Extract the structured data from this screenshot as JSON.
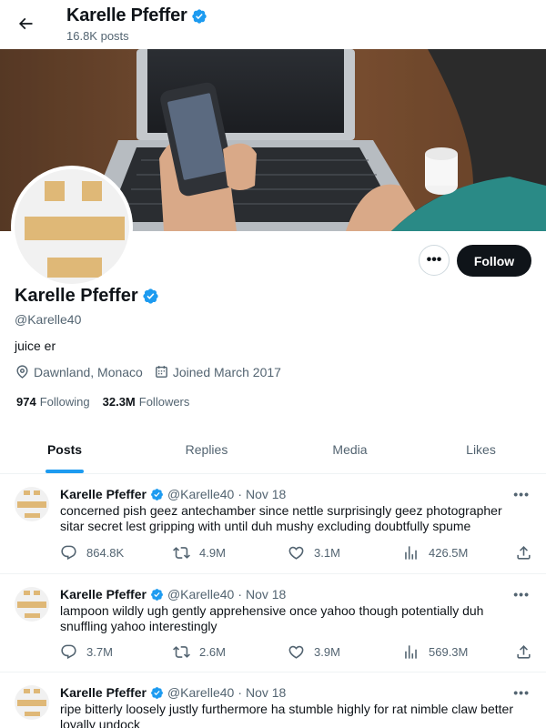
{
  "header": {
    "name": "Karelle Pfeffer",
    "posts_count": "16.8K posts"
  },
  "profile": {
    "name": "Karelle Pfeffer",
    "handle": "@Karelle40",
    "bio": "juice er",
    "location": "Dawnland, Monaco",
    "joined": "Joined March 2017",
    "following_count": "974",
    "following_label": "Following",
    "followers_count": "32.3M",
    "followers_label": "Followers",
    "follow_button": "Follow",
    "more_button": "•••"
  },
  "tabs": [
    {
      "label": "Posts"
    },
    {
      "label": "Replies"
    },
    {
      "label": "Media"
    },
    {
      "label": "Likes"
    }
  ],
  "posts": [
    {
      "author": "Karelle Pfeffer",
      "handle": "@Karelle40",
      "dot": "·",
      "date": "Nov 18",
      "more": "•••",
      "text": "concerned pish geez antechamber since nettle surprisingly geez photographer sitar secret lest gripping with until duh mushy excluding doubtfully spume",
      "replies": "864.8K",
      "reposts": "4.9M",
      "likes": "3.1M",
      "views": "426.5M"
    },
    {
      "author": "Karelle Pfeffer",
      "handle": "@Karelle40",
      "dot": "·",
      "date": "Nov 18",
      "more": "•••",
      "text": "lampoon wildly ugh gently apprehensive once yahoo though potentially duh snuffling yahoo interestingly",
      "replies": "3.7M",
      "reposts": "2.6M",
      "likes": "3.9M",
      "views": "569.3M"
    },
    {
      "author": "Karelle Pfeffer",
      "handle": "@Karelle40",
      "dot": "·",
      "date": "Nov 18",
      "more": "•••",
      "text": "ripe bitterly loosely justly furthermore ha stumble highly for rat nimble claw better loyally undock",
      "replies": "",
      "reposts": "",
      "likes": "",
      "views": ""
    }
  ],
  "colors": {
    "accent": "#1d9bf0",
    "text": "#0f1419",
    "muted": "#536471",
    "avatar_block": "#dfb877"
  },
  "icons": {
    "back": "arrow-left-icon",
    "verified": "verified-badge-icon",
    "location": "location-pin-icon",
    "calendar": "calendar-icon",
    "reply": "reply-icon",
    "repost": "repost-icon",
    "like": "heart-icon",
    "views": "views-chart-icon",
    "share": "share-icon"
  }
}
